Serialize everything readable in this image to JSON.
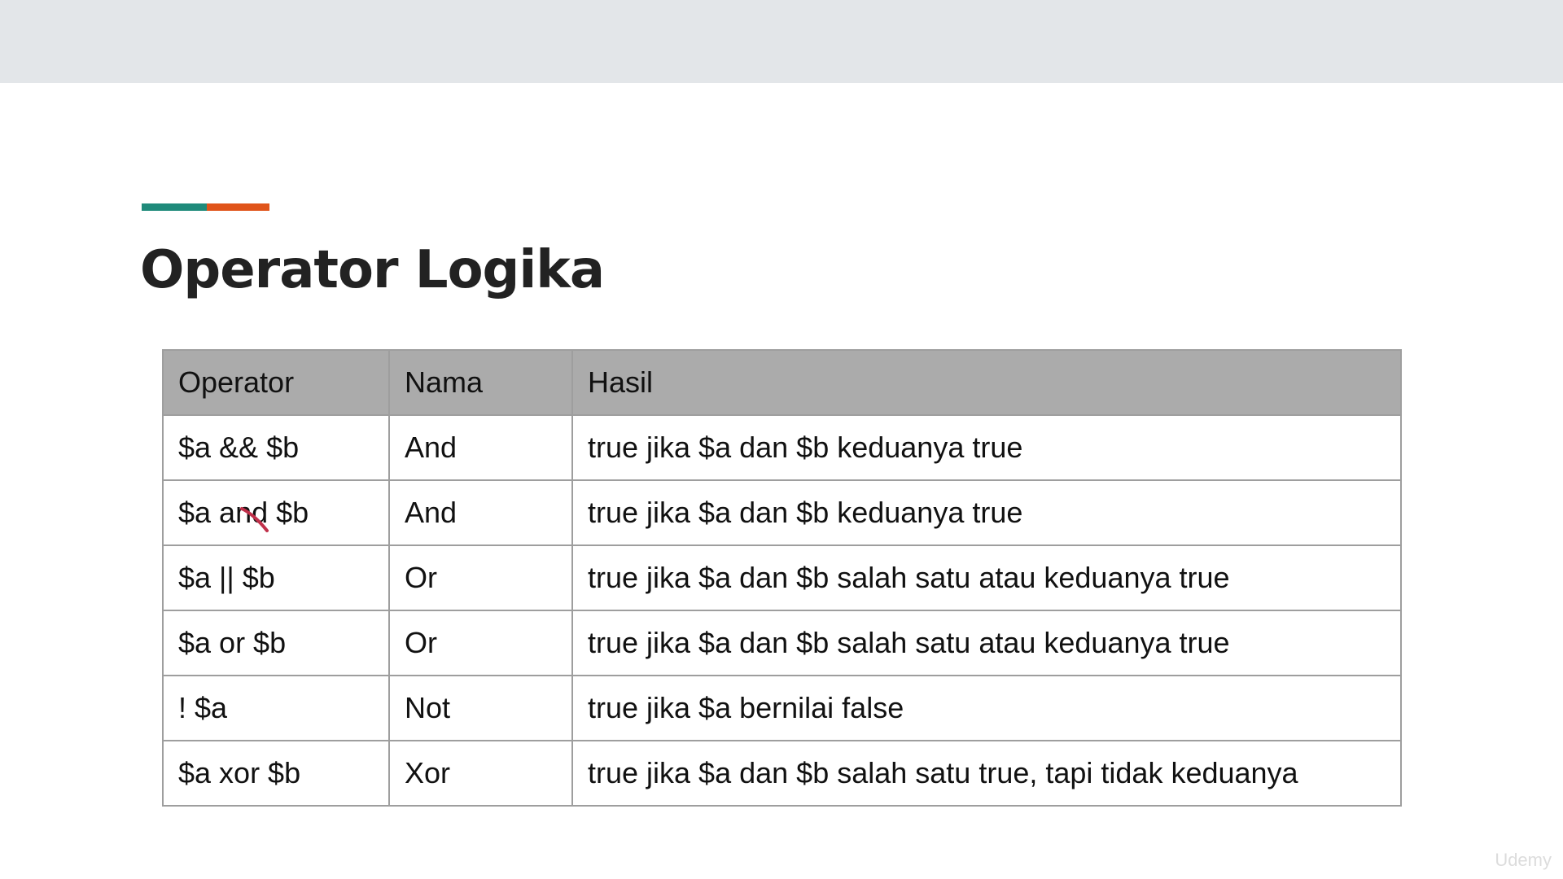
{
  "slide": {
    "title": "Operator Logika",
    "accent_colors": [
      "#1f8a7a",
      "#e0541a"
    ]
  },
  "table": {
    "headers": [
      "Operator",
      "Nama",
      "Hasil"
    ],
    "rows": [
      [
        "$a && $b",
        "And",
        "true jika $a dan $b keduanya true"
      ],
      [
        "$a and $b",
        "And",
        "true jika $a dan $b keduanya true"
      ],
      [
        "$a || $b",
        "Or",
        "true jika $a dan $b salah satu atau keduanya true"
      ],
      [
        "$a or $b",
        "Or",
        "true jika $a dan $b salah satu atau keduanya true"
      ],
      [
        "! $a",
        "Not",
        "true jika $a bernilai false"
      ],
      [
        "$a xor $b",
        "Xor",
        "true jika $a dan $b salah satu true, tapi tidak keduanya"
      ]
    ]
  },
  "watermark": {
    "text": "Udemy"
  },
  "colors": {
    "header_bg": "#ababab",
    "border": "#9e9e9e",
    "top_bar": "#e3e6e9",
    "pen_mark": "#c0304a"
  }
}
